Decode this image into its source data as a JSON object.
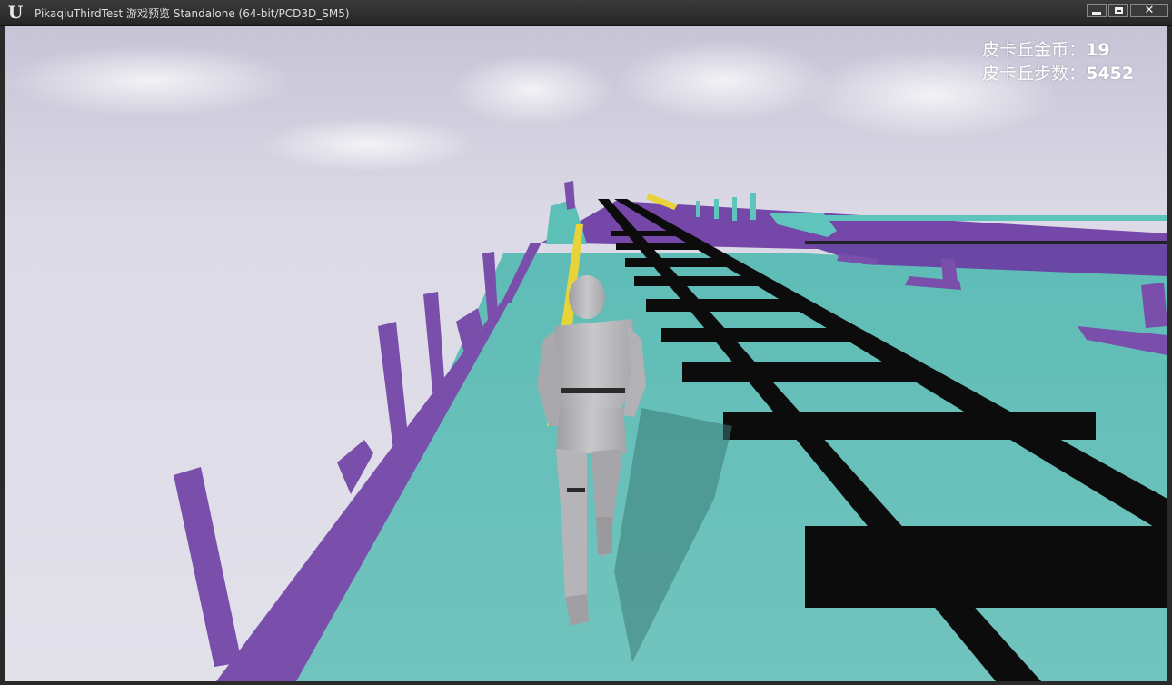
{
  "window": {
    "title": "PikaqiuThirdTest 游戏预览 Standalone (64-bit/PCD3D_SM5)",
    "logo_icon": "unreal-engine-logo"
  },
  "hud": {
    "coins_label": "皮卡丘金币：",
    "coins_value": "19",
    "steps_label": "皮卡丘步数：",
    "steps_value": "5452"
  },
  "colors": {
    "floor": "#6cc0bb",
    "rail_purple": "#7a4eab",
    "rail_teal": "#5fc4bc",
    "track_black": "#0c0c0c",
    "stripe_yellow": "#e8d43a",
    "character": "#b9b9bc"
  }
}
